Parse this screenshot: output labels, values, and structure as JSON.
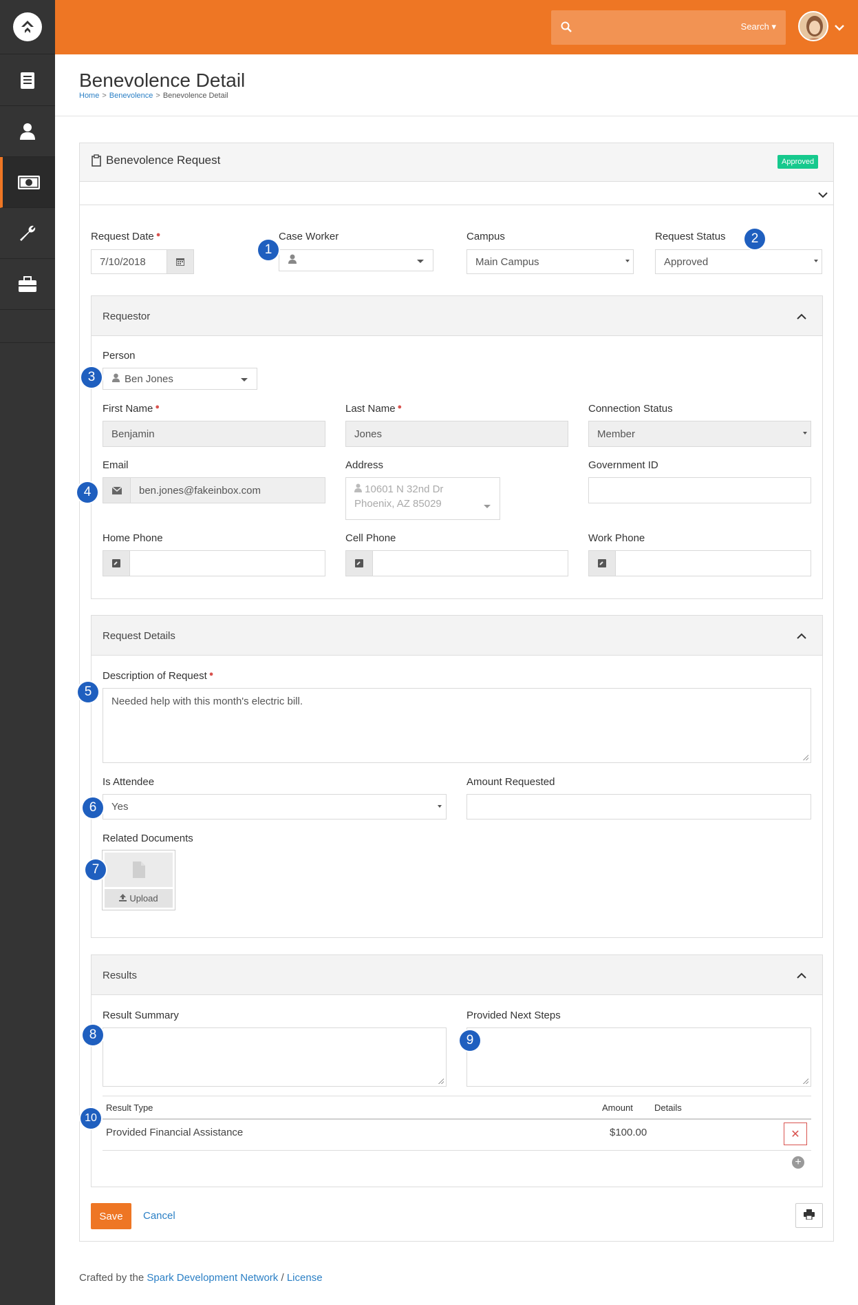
{
  "header": {
    "search_placeholder": "",
    "search_button": "Search"
  },
  "page": {
    "title": "Benevolence Detail",
    "breadcrumb": [
      "Home",
      "Benevolence",
      "Benevolence Detail"
    ]
  },
  "panel": {
    "title": "Benevolence Request",
    "status_badge": "Approved"
  },
  "request": {
    "request_date_label": "Request Date",
    "request_date": "7/10/2018",
    "case_worker_label": "Case Worker",
    "case_worker": "",
    "campus_label": "Campus",
    "campus": "Main Campus",
    "status_label": "Request Status",
    "status": "Approved"
  },
  "requestor": {
    "title": "Requestor",
    "person_label": "Person",
    "person": "Ben Jones",
    "first_name_label": "First Name",
    "first_name": "Benjamin",
    "last_name_label": "Last Name",
    "last_name": "Jones",
    "connection_label": "Connection Status",
    "connection": "Member",
    "email_label": "Email",
    "email": "ben.jones@fakeinbox.com",
    "address_label": "Address",
    "address_line1": "10601 N 32nd Dr",
    "address_line2": "Phoenix, AZ 85029",
    "gov_id_label": "Government ID",
    "gov_id": "",
    "home_phone_label": "Home Phone",
    "cell_phone_label": "Cell Phone",
    "work_phone_label": "Work Phone"
  },
  "details": {
    "title": "Request Details",
    "description_label": "Description of Request",
    "description": "Needed help with this month's electric bill.",
    "attendee_label": "Is Attendee",
    "attendee": "Yes",
    "amount_label": "Amount Requested",
    "amount": "",
    "documents_label": "Related Documents",
    "upload_label": "Upload"
  },
  "results": {
    "title": "Results",
    "summary_label": "Result Summary",
    "next_steps_label": "Provided Next Steps",
    "columns": [
      "Result Type",
      "Amount",
      "Details"
    ],
    "rows": [
      {
        "type": "Provided Financial Assistance",
        "amount": "$100.00",
        "details": ""
      }
    ]
  },
  "actions": {
    "save": "Save",
    "cancel": "Cancel"
  },
  "footer": {
    "prefix": "Crafted by the ",
    "org": "Spark Development Network",
    "sep": " / ",
    "license": "License"
  },
  "markers": [
    "1",
    "2",
    "3",
    "4",
    "5",
    "6",
    "7",
    "8",
    "9",
    "10"
  ],
  "colors": {
    "brand": "#ee7624",
    "sidebar": "#343434",
    "approved": "#16c98d",
    "link": "#2a7fc5",
    "marker": "#1f5fbf"
  }
}
